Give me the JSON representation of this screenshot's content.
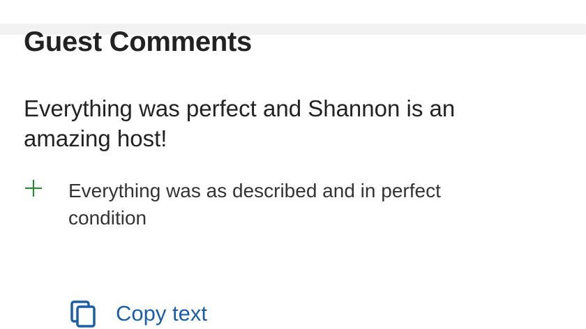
{
  "section": {
    "title": "Guest Comments"
  },
  "comment": {
    "headline": "Everything was perfect and Shannon is an amazing host!",
    "pros": [
      {
        "icon": "plus-icon",
        "text": "Everything was as described and in perfect condition"
      }
    ]
  },
  "actions": {
    "copy_label": "Copy text",
    "copy_icon": "copy-icon"
  },
  "colors": {
    "text": "#222222",
    "positive": "#1e8a2e",
    "link": "#1a5fa8",
    "separator": "#f2f2f2"
  }
}
